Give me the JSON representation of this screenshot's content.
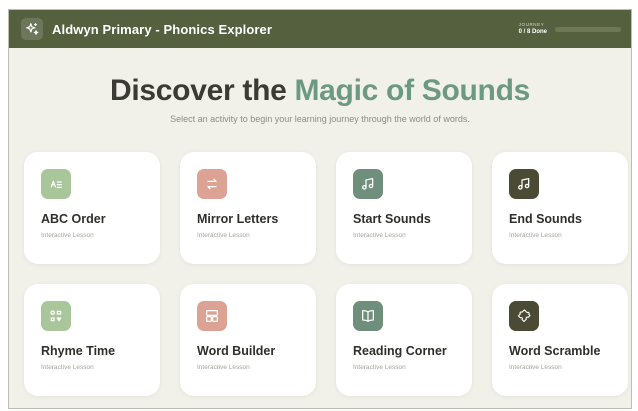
{
  "app": {
    "title": "Aldwyn Primary - Phonics Explorer",
    "logo_icon": "sparkles-icon"
  },
  "journey": {
    "label": "JOURNEY",
    "value": "0 / 8 Done",
    "progress_fraction": 0
  },
  "hero": {
    "title_main": "Discover the",
    "title_accent": "Magic of Sounds",
    "subtitle": "Select an activity to begin your learning journey through the world of words."
  },
  "activities": [
    {
      "title": "ABC Order",
      "subtitle": "Interactive Lesson",
      "icon": "sort-alpha-icon",
      "color": "#a8c69a"
    },
    {
      "title": "Mirror Letters",
      "subtitle": "Interactive Lesson",
      "icon": "swap-arrows-icon",
      "color": "#dca395"
    },
    {
      "title": "Start Sounds",
      "subtitle": "Interactive Lesson",
      "icon": "music-note-icon",
      "color": "#6f8f7d"
    },
    {
      "title": "End Sounds",
      "subtitle": "Interactive Lesson",
      "icon": "music-note-icon",
      "color": "#4a4a35"
    },
    {
      "title": "Rhyme Time",
      "subtitle": "Interactive Lesson",
      "icon": "shapes-icon",
      "color": "#a8c69a"
    },
    {
      "title": "Word Builder",
      "subtitle": "Interactive Lesson",
      "icon": "layout-blocks-icon",
      "color": "#dca395"
    },
    {
      "title": "Reading Corner",
      "subtitle": "Interactive Lesson",
      "icon": "open-book-icon",
      "color": "#6f8f7d"
    },
    {
      "title": "Word Scramble",
      "subtitle": "Interactive Lesson",
      "icon": "puzzle-icon",
      "color": "#4a4a35"
    }
  ],
  "colors": {
    "topbar": "#55603f",
    "accent": "#6b9a80",
    "background": "#f1f1ea"
  }
}
